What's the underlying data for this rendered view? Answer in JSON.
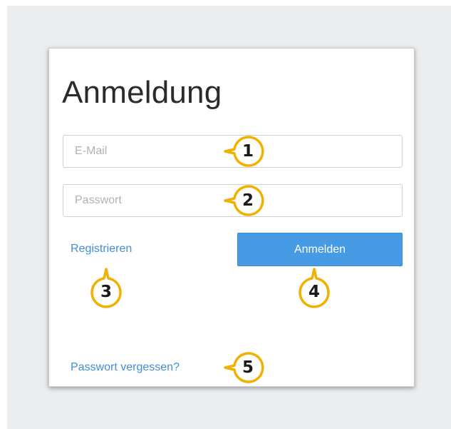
{
  "login": {
    "title": "Anmeldung",
    "email_placeholder": "E-Mail",
    "password_placeholder": "Passwort",
    "register_label": "Registrieren",
    "login_button_label": "Anmelden",
    "forgot_password_label": "Passwort vergessen?"
  },
  "callouts": {
    "c1": "1",
    "c2": "2",
    "c3": "3",
    "c4": "4",
    "c5": "5"
  },
  "colors": {
    "accent": "#469be4",
    "link": "#3f8ed9",
    "callout_ring": "#f2b000",
    "background": "#ebedef"
  }
}
